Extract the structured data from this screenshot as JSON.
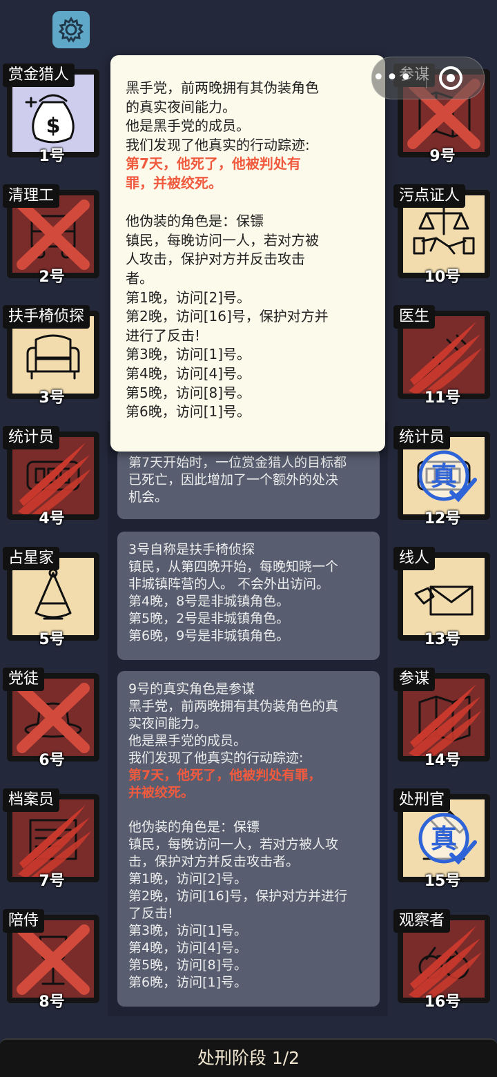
{
  "settings_icon": "gear-icon",
  "capsule": {
    "more_icon": "more-dots-icon",
    "close_icon": "target-icon"
  },
  "cards": [
    {
      "role": "赏金猎人",
      "num": "1号",
      "icon": "money-bag-icon",
      "state": "blue"
    },
    {
      "role": "清理工",
      "num": "2号",
      "icon": "cleaner-cart-icon",
      "state": "dead-x"
    },
    {
      "role": "扶手椅侦探",
      "num": "3号",
      "icon": "armchair-icon",
      "state": "alive"
    },
    {
      "role": "统计员",
      "num": "4号",
      "icon": "abacus-icon",
      "state": "claw"
    },
    {
      "role": "占星家",
      "num": "5号",
      "icon": "sextant-icon",
      "state": "alive"
    },
    {
      "role": "党徒",
      "num": "6号",
      "icon": "hat-icon",
      "state": "dead-x"
    },
    {
      "role": "档案员",
      "num": "7号",
      "icon": "archive-icon",
      "state": "claw"
    },
    {
      "role": "陪侍",
      "num": "8号",
      "icon": "wine-glass-icon",
      "state": "dead-x"
    },
    {
      "role": "参谋",
      "num": "9号",
      "icon": "map-icon",
      "state": "dead-x"
    },
    {
      "role": "污点证人",
      "num": "10号",
      "icon": "scales-handshake-icon",
      "state": "alive"
    },
    {
      "role": "医生",
      "num": "11号",
      "icon": "syringe-icon",
      "state": "claw"
    },
    {
      "role": "统计员",
      "num": "12号",
      "icon": "abacus-icon",
      "state": "true-stamp"
    },
    {
      "role": "线人",
      "num": "13号",
      "icon": "envelope-icon",
      "state": "alive"
    },
    {
      "role": "参谋",
      "num": "14号",
      "icon": "map-icon",
      "state": "claw"
    },
    {
      "role": "处刑官",
      "num": "15号",
      "icon": "executioner-icon",
      "state": "true-stamp"
    },
    {
      "role": "观察者",
      "num": "16号",
      "icon": "binoculars-icon",
      "state": "claw"
    }
  ],
  "stamp_text": "真",
  "popup": {
    "lines_a": [
      "黑手党，前两晚拥有其伪装角色",
      "的真实夜间能力。",
      "他是黑手党的成员。",
      "我们发现了他真实的行动踪迹:"
    ],
    "red_lines": [
      "第7天，他死了，他被判处有",
      "罪，并被绞死。"
    ],
    "lines_b": [
      "他伪装的角色是：保镖",
      "镇民，每晚访问一人，若对方被",
      "人攻击，保护对方并反击攻击",
      "者。",
      "第1晚，访问[2]号。",
      "第2晚，访问[16]号，保护对方并",
      "进行了反击!",
      "第3晚，访问[1]号。",
      "第4晚，访问[4]号。",
      "第5晚，访问[8]号。",
      "第6晚，访问[1]号。"
    ]
  },
  "messages": {
    "m1": [
      "第7天开始时，一位赏金猎人的目标都",
      "已死亡，因此增加了一个额外的处决",
      "机会。"
    ],
    "m2": [
      "3号自称是扶手椅侦探",
      "镇民，从第四晚开始，每晚知晓一个",
      "非城镇阵营的人。 不会外出访问。",
      "第4晚，8号是非城镇角色。",
      "第5晚，2号是非城镇角色。",
      "第6晚，9号是非城镇角色。"
    ],
    "m3_a": [
      "9号的真实角色是参谋",
      "黑手党，前两晚拥有其伪装角色的真",
      "实夜间能力。",
      "他是黑手党的成员。",
      "我们发现了他真实的行动踪迹:"
    ],
    "m3_red": [
      "第7天，他死了，他被判处有罪，",
      "并被绞死。"
    ],
    "m3_b": [
      "他伪装的角色是：保镖",
      "镇民，每晚访问一人，若对方被人攻",
      "击，保护对方并反击攻击者。",
      "第1晚，访问[2]号。",
      "第2晚，访问[16]号，保护对方并进行",
      "了反击!",
      "第3晚，访问[1]号。",
      "第4晚，访问[4]号。",
      "第5晚，访问[8]号。",
      "第6晚，访问[1]号。"
    ]
  },
  "bottom_bar": {
    "label": "处刑阶段 1/2"
  },
  "colors": {
    "background": "#23283a",
    "card_alive": "#f2dcae",
    "card_dead": "#7a2c2a",
    "card_blue": "#cfcdee",
    "red_text": "#f05a3e",
    "stamp_blue": "#2f63d8",
    "x_red": "#d24a3c"
  }
}
